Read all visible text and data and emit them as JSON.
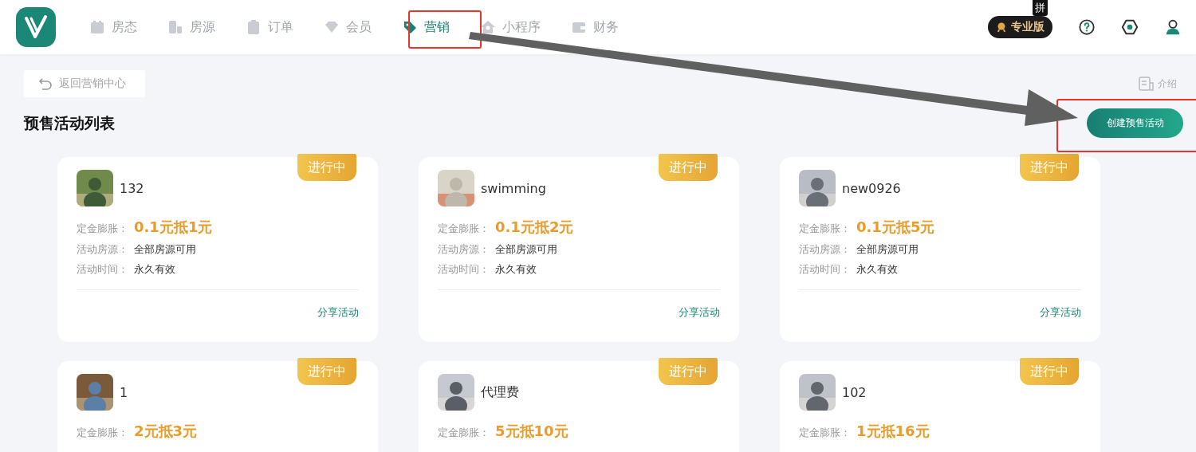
{
  "nav": {
    "items": [
      {
        "label": "房态",
        "selected": false
      },
      {
        "label": "房源",
        "selected": false
      },
      {
        "label": "订单",
        "selected": false
      },
      {
        "label": "会员",
        "selected": false
      },
      {
        "label": "营销",
        "selected": true
      },
      {
        "label": "小程序",
        "selected": false
      },
      {
        "label": "财务",
        "selected": false
      }
    ],
    "plan_badge": "专业版",
    "ime_tooltip": "拼"
  },
  "back_button": "返回营销中心",
  "intro_link": "介绍",
  "title": "预售活动列表",
  "create_button": "创建预售活动",
  "cards": [
    {
      "name": "132",
      "status": "进行中",
      "fields": [
        {
          "label": "定金膨胀：",
          "value": "0.1元抵1元",
          "kind": "price"
        },
        {
          "label": "活动房源：",
          "value": "全部房源可用",
          "kind": "text"
        },
        {
          "label": "活动时间：",
          "value": "永久有效",
          "kind": "text"
        }
      ],
      "share": "分享活动"
    },
    {
      "name": "swimming",
      "status": "进行中",
      "fields": [
        {
          "label": "定金膨胀：",
          "value": "0.1元抵2元",
          "kind": "price"
        },
        {
          "label": "活动房源：",
          "value": "全部房源可用",
          "kind": "text"
        },
        {
          "label": "活动时间：",
          "value": "永久有效",
          "kind": "text"
        }
      ],
      "share": "分享活动"
    },
    {
      "name": "new0926",
      "status": "进行中",
      "fields": [
        {
          "label": "定金膨胀：",
          "value": "0.1元抵5元",
          "kind": "price"
        },
        {
          "label": "活动房源：",
          "value": "全部房源可用",
          "kind": "text"
        },
        {
          "label": "活动时间：",
          "value": "永久有效",
          "kind": "text"
        }
      ],
      "share": "分享活动"
    },
    {
      "name": "1",
      "status": "进行中",
      "fields": [
        {
          "label": "定金膨胀：",
          "value": "2元抵3元",
          "kind": "price"
        }
      ]
    },
    {
      "name": "代理费",
      "status": "进行中",
      "fields": [
        {
          "label": "定金膨胀：",
          "value": "5元抵10元",
          "kind": "price"
        }
      ]
    },
    {
      "name": "102",
      "status": "进行中",
      "fields": [
        {
          "label": "定金膨胀：",
          "value": "1元抵16元",
          "kind": "price"
        }
      ]
    }
  ]
}
